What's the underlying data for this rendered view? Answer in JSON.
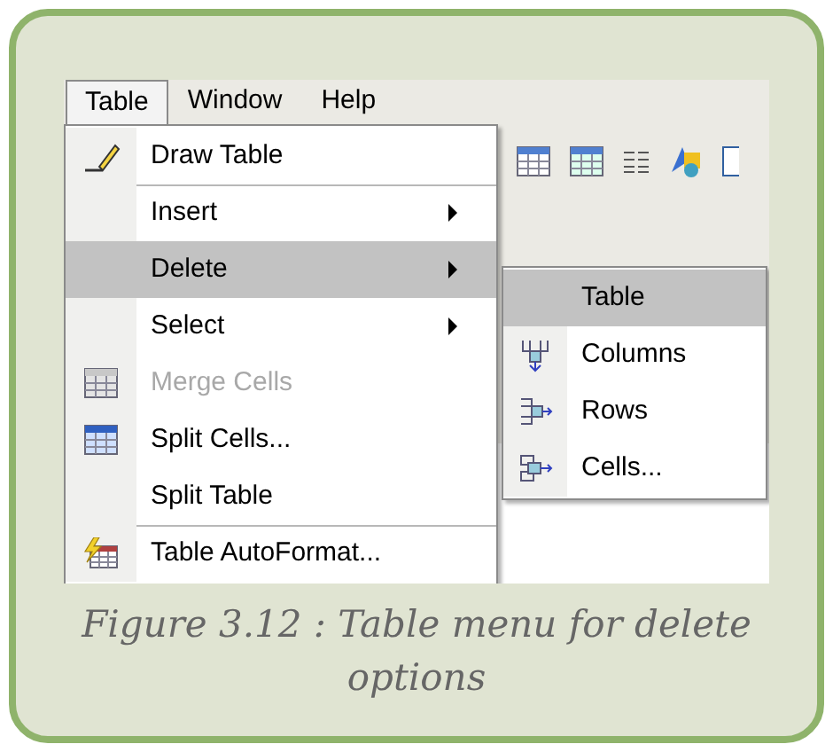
{
  "menu_bar": [
    {
      "label": "Table",
      "selected": true
    },
    {
      "label": "Window",
      "selected": false
    },
    {
      "label": "Help",
      "selected": false
    }
  ],
  "table_menu": [
    {
      "label": "Draw Table",
      "selected": false,
      "disabled": false,
      "submenu": false,
      "divider_above": false
    },
    {
      "label": "Insert",
      "selected": false,
      "disabled": false,
      "submenu": true,
      "divider_above": true
    },
    {
      "label": "Delete",
      "selected": true,
      "disabled": false,
      "submenu": true,
      "divider_above": false
    },
    {
      "label": "Select",
      "selected": false,
      "disabled": false,
      "submenu": true,
      "divider_above": false
    },
    {
      "label": "Merge Cells",
      "selected": false,
      "disabled": true,
      "submenu": false,
      "divider_above": false
    },
    {
      "label": "Split Cells...",
      "selected": false,
      "disabled": false,
      "submenu": false,
      "divider_above": false
    },
    {
      "label": "Split Table",
      "selected": false,
      "disabled": false,
      "submenu": false,
      "divider_above": false
    },
    {
      "label": "Table AutoFormat...",
      "selected": false,
      "disabled": false,
      "submenu": false,
      "divider_above": true
    }
  ],
  "delete_submenu": [
    {
      "label": "Table",
      "selected": true
    },
    {
      "label": "Columns",
      "selected": false
    },
    {
      "label": "Rows",
      "selected": false
    },
    {
      "label": "Cells...",
      "selected": false
    }
  ],
  "caption": "Figure 3.12 : Table menu for delete options"
}
